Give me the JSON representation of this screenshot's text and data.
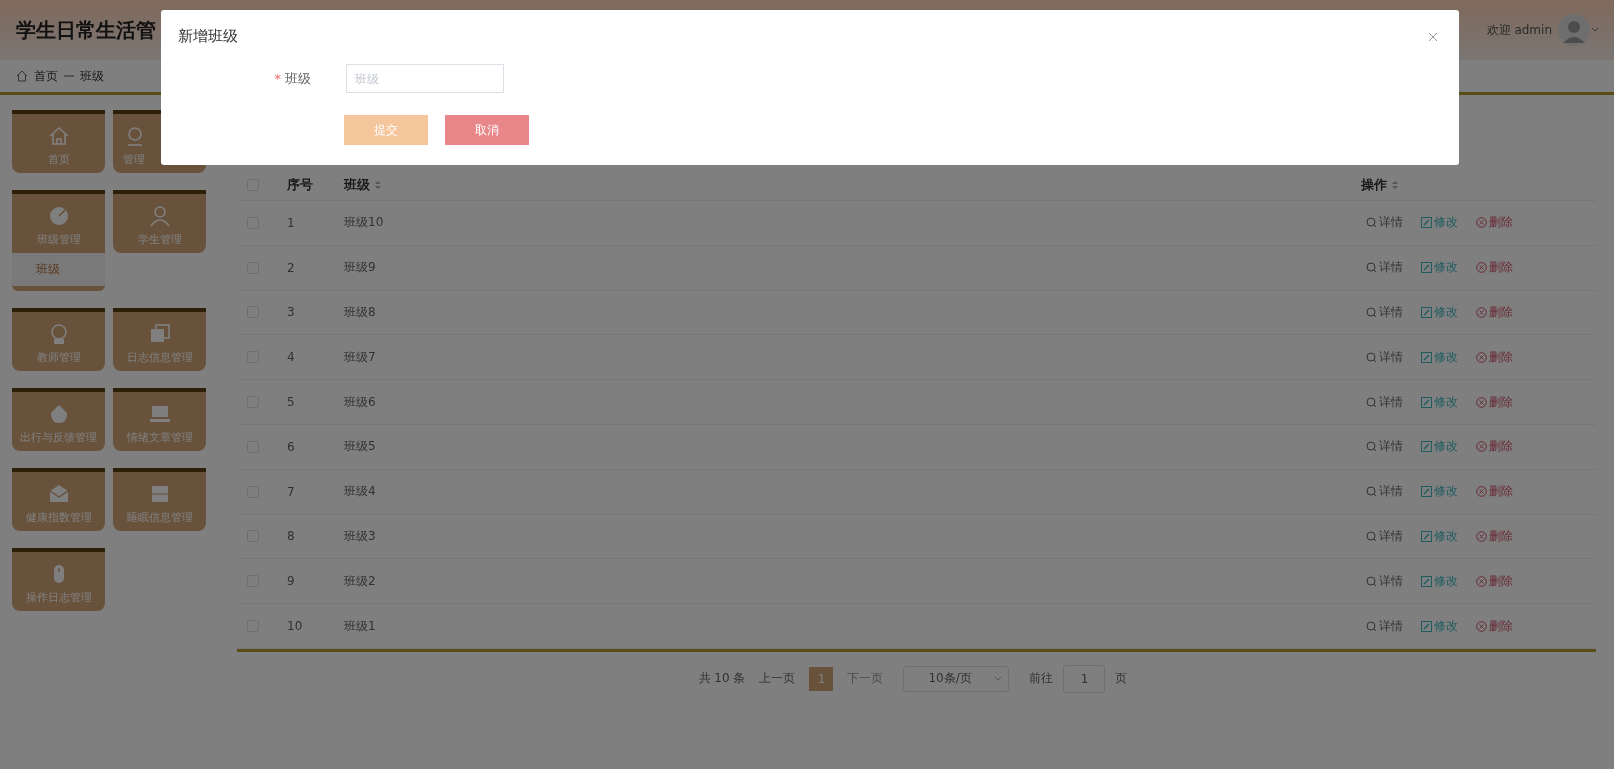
{
  "header": {
    "title": "学生日常生活管",
    "welcome": "欢迎 admin"
  },
  "breadcrumb": [
    "首页",
    "班级"
  ],
  "sidebar": {
    "items": [
      {
        "label": "首页",
        "expanded": false
      },
      {
        "label": "管理",
        "expanded": false
      },
      {
        "label": "班级管理",
        "expanded": true,
        "children": [
          {
            "label": "班级",
            "selected": true
          }
        ]
      },
      {
        "label": "学生管理",
        "expanded": false
      },
      {
        "label": "教师管理",
        "expanded": false
      },
      {
        "label": "日志信息管理",
        "expanded": false
      },
      {
        "label": "出行与反馈管理",
        "expanded": false
      },
      {
        "label": "情绪文章管理",
        "expanded": false
      },
      {
        "label": "健康指数管理",
        "expanded": false
      },
      {
        "label": "睡眠信息管理",
        "expanded": false
      },
      {
        "label": "操作日志管理",
        "expanded": false
      }
    ]
  },
  "table": {
    "all_checked": false,
    "columns": [
      {
        "label": "序号",
        "sortable": false
      },
      {
        "label": "班级",
        "sortable": true
      },
      {
        "label": "操作",
        "sortable": true
      }
    ],
    "rows": [
      {
        "index": "1",
        "name": "班级10",
        "checked": false,
        "actions": [
          {
            "kind": "detail",
            "label": "详情"
          },
          {
            "kind": "edit",
            "label": "修改"
          },
          {
            "kind": "delete",
            "label": "删除"
          }
        ]
      },
      {
        "index": "2",
        "name": "班级9",
        "checked": false,
        "actions": [
          {
            "kind": "detail",
            "label": "详情"
          },
          {
            "kind": "edit",
            "label": "修改"
          },
          {
            "kind": "delete",
            "label": "删除"
          }
        ]
      },
      {
        "index": "3",
        "name": "班级8",
        "checked": false,
        "actions": [
          {
            "kind": "detail",
            "label": "详情"
          },
          {
            "kind": "edit",
            "label": "修改"
          },
          {
            "kind": "delete",
            "label": "删除"
          }
        ]
      },
      {
        "index": "4",
        "name": "班级7",
        "checked": false,
        "actions": [
          {
            "kind": "detail",
            "label": "详情"
          },
          {
            "kind": "edit",
            "label": "修改"
          },
          {
            "kind": "delete",
            "label": "删除"
          }
        ]
      },
      {
        "index": "5",
        "name": "班级6",
        "checked": false,
        "actions": [
          {
            "kind": "detail",
            "label": "详情"
          },
          {
            "kind": "edit",
            "label": "修改"
          },
          {
            "kind": "delete",
            "label": "删除"
          }
        ]
      },
      {
        "index": "6",
        "name": "班级5",
        "checked": false,
        "actions": [
          {
            "kind": "detail",
            "label": "详情"
          },
          {
            "kind": "edit",
            "label": "修改"
          },
          {
            "kind": "delete",
            "label": "删除"
          }
        ]
      },
      {
        "index": "7",
        "name": "班级4",
        "checked": false,
        "actions": [
          {
            "kind": "detail",
            "label": "详情"
          },
          {
            "kind": "edit",
            "label": "修改"
          },
          {
            "kind": "delete",
            "label": "删除"
          }
        ]
      },
      {
        "index": "8",
        "name": "班级3",
        "checked": false,
        "actions": [
          {
            "kind": "detail",
            "label": "详情"
          },
          {
            "kind": "edit",
            "label": "修改"
          },
          {
            "kind": "delete",
            "label": "删除"
          }
        ]
      },
      {
        "index": "9",
        "name": "班级2",
        "checked": false,
        "actions": [
          {
            "kind": "detail",
            "label": "详情"
          },
          {
            "kind": "edit",
            "label": "修改"
          },
          {
            "kind": "delete",
            "label": "删除"
          }
        ]
      },
      {
        "index": "10",
        "name": "班级1",
        "checked": false,
        "actions": [
          {
            "kind": "detail",
            "label": "详情"
          },
          {
            "kind": "edit",
            "label": "修改"
          },
          {
            "kind": "delete",
            "label": "删除"
          }
        ]
      }
    ]
  },
  "pagination": {
    "total": "共 10 条",
    "prev": "上一页",
    "pages": [
      {
        "label": "1",
        "selected": true
      }
    ],
    "next": "下一页",
    "page_size": "10条/页",
    "goto_label": "前往",
    "goto_value": "1",
    "goto_suffix": "页"
  },
  "dialog": {
    "title": "新增班级",
    "field": {
      "required_mark": "*",
      "label": "班级",
      "placeholder": "班级"
    },
    "buttons": [
      {
        "kind": "submit",
        "label": "提交"
      },
      {
        "kind": "cancel",
        "label": "取消"
      }
    ]
  }
}
